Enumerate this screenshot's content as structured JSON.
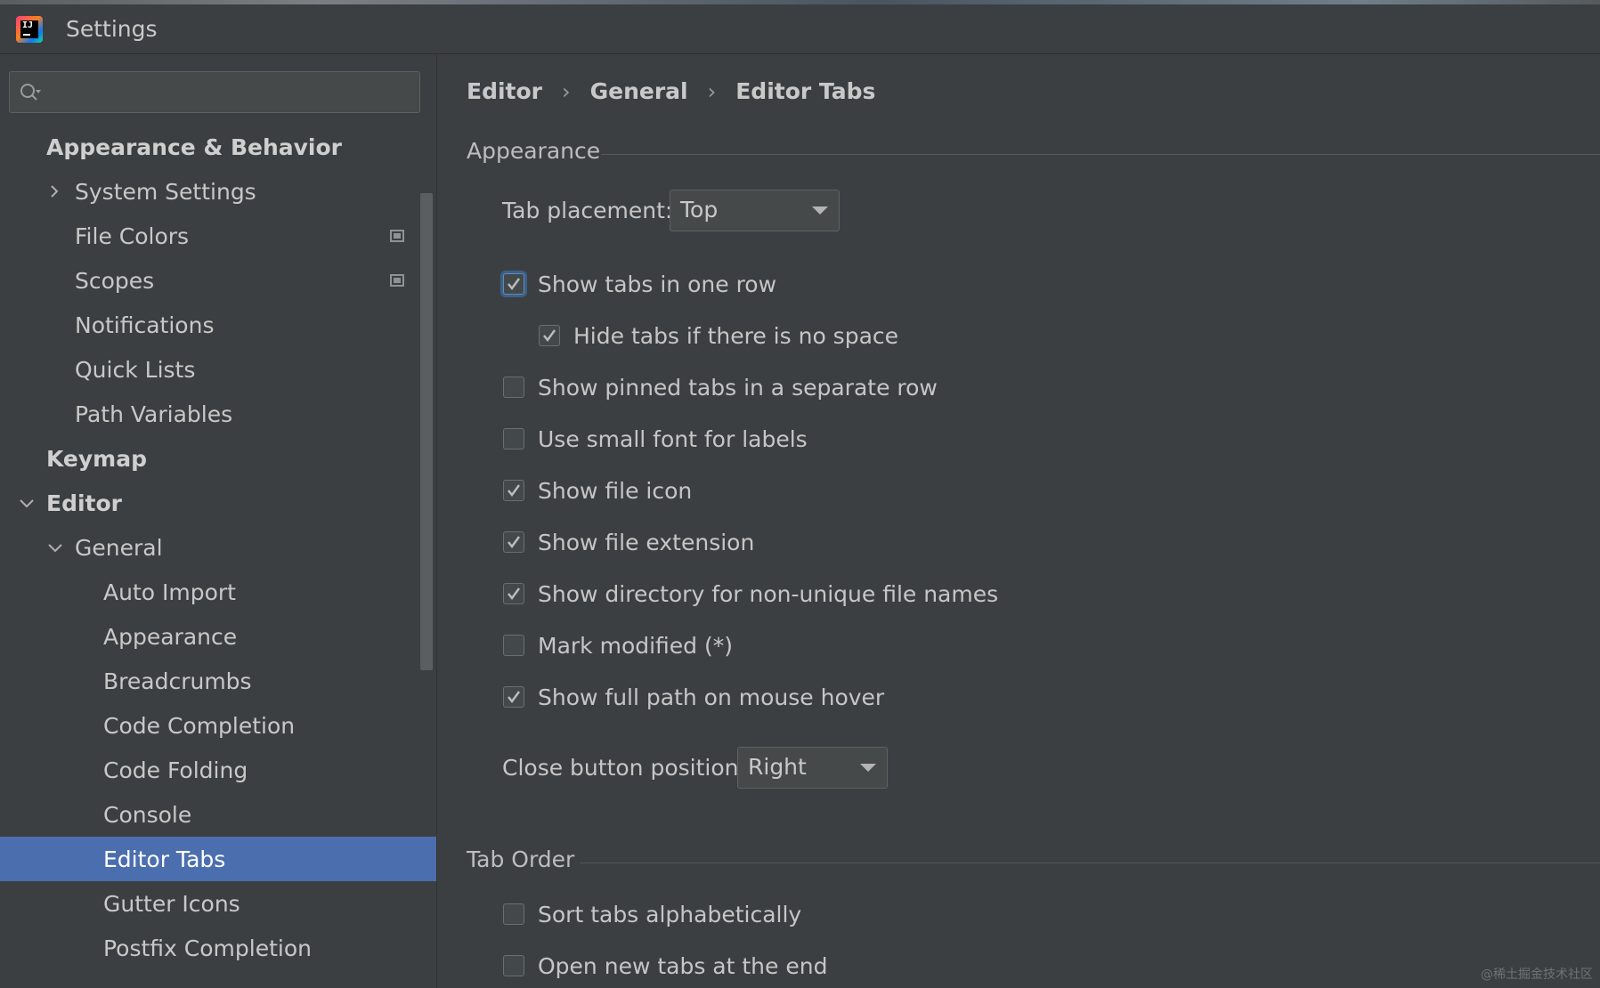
{
  "window": {
    "title": "Settings"
  },
  "search": {
    "placeholder": ""
  },
  "sidebar": {
    "items": [
      {
        "label": "Appearance & Behavior"
      },
      {
        "label": "System Settings"
      },
      {
        "label": "File Colors"
      },
      {
        "label": "Scopes"
      },
      {
        "label": "Notifications"
      },
      {
        "label": "Quick Lists"
      },
      {
        "label": "Path Variables"
      },
      {
        "label": "Keymap"
      },
      {
        "label": "Editor"
      },
      {
        "label": "General"
      },
      {
        "label": "Auto Import"
      },
      {
        "label": "Appearance"
      },
      {
        "label": "Breadcrumbs"
      },
      {
        "label": "Code Completion"
      },
      {
        "label": "Code Folding"
      },
      {
        "label": "Console"
      },
      {
        "label": "Editor Tabs"
      },
      {
        "label": "Gutter Icons"
      },
      {
        "label": "Postfix Completion"
      }
    ]
  },
  "breadcrumb": {
    "items": [
      "Editor",
      "General",
      "Editor Tabs"
    ],
    "separator": "›"
  },
  "sections": {
    "appearance": {
      "title": "Appearance"
    },
    "tab_order": {
      "title": "Tab Order"
    }
  },
  "tab_placement": {
    "label": "Tab placement:",
    "value": "Top"
  },
  "close_button": {
    "label": "Close button position:",
    "value": "Right"
  },
  "options": [
    {
      "label": "Show tabs in one row",
      "checked": true
    },
    {
      "label": "Hide tabs if there is no space",
      "checked": true
    },
    {
      "label": "Show pinned tabs in a separate row",
      "checked": false
    },
    {
      "label": "Use small font for labels",
      "checked": false
    },
    {
      "label": "Show file icon",
      "checked": true
    },
    {
      "label": "Show file extension",
      "checked": true
    },
    {
      "label": "Show directory for non-unique file names",
      "checked": true
    },
    {
      "label": "Mark modified (*)",
      "checked": false
    },
    {
      "label": "Show full path on mouse hover",
      "checked": true
    }
  ],
  "tab_order_options": [
    {
      "label": "Sort tabs alphabetically",
      "checked": false
    },
    {
      "label": "Open new tabs at the end",
      "checked": false
    }
  ],
  "watermark": "@稀土掘金技术社区",
  "colors": {
    "background": "#3c3f41",
    "selection": "#4b6eaf",
    "text": "#bbbbbb",
    "focus": "#3d6185"
  }
}
